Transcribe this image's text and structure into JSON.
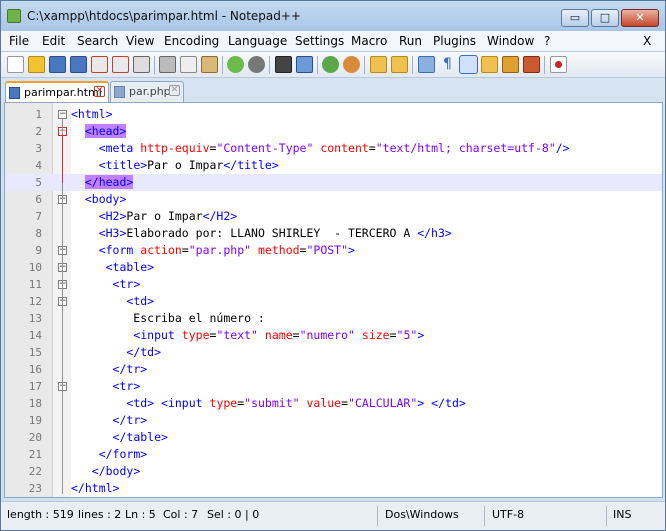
{
  "window": {
    "title": "C:\\xampp\\htdocs\\parimpar.html - Notepad++",
    "min_glyph": "▭",
    "max_glyph": "□",
    "close_glyph": "✕"
  },
  "menu": [
    "File",
    "Edit",
    "Search",
    "View",
    "Encoding",
    "Language",
    "Settings",
    "Macro",
    "Run",
    "Plugins",
    "Window",
    "?"
  ],
  "menu_close": "X",
  "toolbar_icons": [
    "new-file-icon",
    "open-file-icon",
    "save-icon",
    "save-all-icon",
    "close-icon",
    "close-all-icon",
    "print-icon",
    "cut-icon",
    "copy-icon",
    "paste-icon",
    "undo-icon",
    "redo-icon",
    "find-icon",
    "replace-icon",
    "zoom-in-icon",
    "zoom-out-icon",
    "sync-vertical-icon",
    "sync-horizontal-icon",
    "word-wrap-icon",
    "show-all-chars-icon",
    "indent-guide-icon",
    "user-lang-icon",
    "doc-map-icon",
    "function-list-icon",
    "record-macro-icon"
  ],
  "tabs": [
    {
      "label": "parimpar.html",
      "active": true
    },
    {
      "label": "par.php",
      "active": false
    }
  ],
  "line_numbers": [
    "1",
    "2",
    "3",
    "4",
    "5",
    "6",
    "7",
    "8",
    "9",
    "10",
    "11",
    "12",
    "13",
    "14",
    "15",
    "16",
    "17",
    "18",
    "19",
    "20",
    "21",
    "22",
    "23"
  ],
  "code_lines": [
    "<html>",
    "  <head>",
    "    <meta http-equiv=\"Content-Type\" content=\"text/html; charset=utf-8\"/>",
    "    <title>Par o Impar</title>",
    "  </head>",
    "  <body>",
    "    <H2>Par o Impar</H2>",
    "    <H3>Elaborado por: LLANO SHIRLEY  - TERCERO A </h3>",
    "    <form action=\"par.php\" method=\"POST\">",
    "     <table>",
    "      <tr>",
    "        <td>",
    "         Escriba el número :",
    "         <input type=\"text\" name=\"numero\" size=\"5\">",
    "        </td>",
    "      </tr>",
    "      <tr>",
    "        <td> <input type=\"submit\" value=\"CALCULAR\"> </td>",
    "      </tr>",
    "      </table>",
    "    </form>",
    "   </body>",
    "</html>"
  ],
  "status": {
    "length": "length : 519",
    "lines": "lines : 2",
    "ln": "Ln : 5",
    "col": "Col : 7",
    "sel": "Sel : 0 | 0",
    "eol": "Dos\\Windows",
    "encoding": "UTF-8",
    "mode": "INS"
  },
  "colors": {
    "tag": "#0000ff",
    "attribute": "#ff0000",
    "value": "#8000ff",
    "match_highlight": "#c080ff",
    "current_line": "#e8e8ff"
  }
}
